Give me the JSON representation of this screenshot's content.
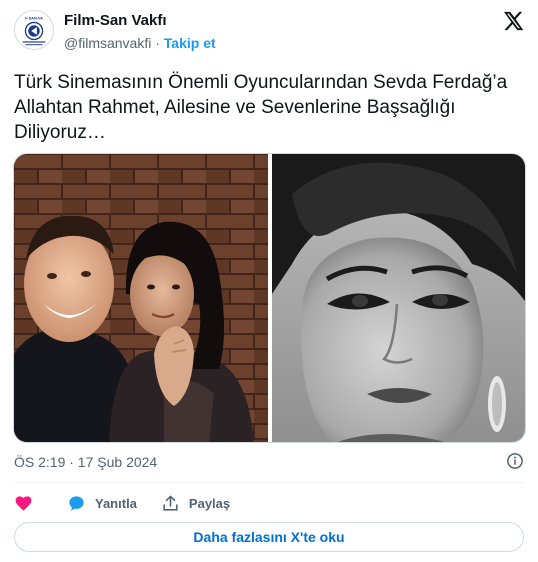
{
  "author": {
    "name": "Film-San Vakfı",
    "handle": "@filmsanvakfi",
    "separator": "·",
    "follow_label": "Takip et",
    "avatar_text_top": "FİLM - SAN VAKFI",
    "avatar_icon": "film-san-logo"
  },
  "tweet": {
    "text": "Türk Sinemasının Önemli Oyuncularından Sevda Ferdağ’a Allahtan Rahmet, Ailesine ve Sevenlerine Başsağlığı Diliyoruz…",
    "media": [
      {
        "icon": "photo-color-selfie"
      },
      {
        "icon": "photo-bw-portrait"
      }
    ],
    "timestamp": "ÖS 2:19 · 17 Şub 2024"
  },
  "actions": {
    "like_icon": "heart-icon",
    "reply_label": "Yanıtla",
    "share_label": "Paylaş"
  },
  "read_more_label": "Daha fazlasını X'te oku",
  "colors": {
    "accent": "#1d9bf0",
    "like": "#f91880",
    "muted": "#536471",
    "link": "#006fd6"
  }
}
